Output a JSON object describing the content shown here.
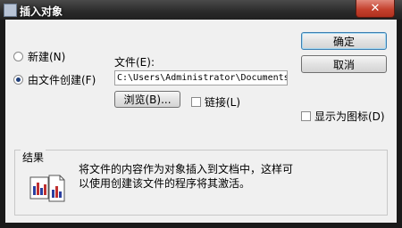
{
  "window": {
    "title": "插入对象",
    "close_glyph": "✕"
  },
  "options": {
    "new_label": "新建(N)",
    "from_file_label": "由文件创建(F)",
    "selected": "from_file"
  },
  "file": {
    "label": "文件(E):",
    "path": "C:\\Users\\Administrator\\Documents",
    "browse_label": "浏览(B)...",
    "link_label": "链接(L)",
    "link_checked": false
  },
  "buttons": {
    "ok_label": "确定",
    "cancel_label": "取消"
  },
  "display_as_icon": {
    "label": "显示为图标(D)",
    "checked": false
  },
  "result": {
    "legend": "结果",
    "description": "将文件的内容作为对象插入到文档中，这样可以使用创建该文件的程序将其激活。"
  }
}
